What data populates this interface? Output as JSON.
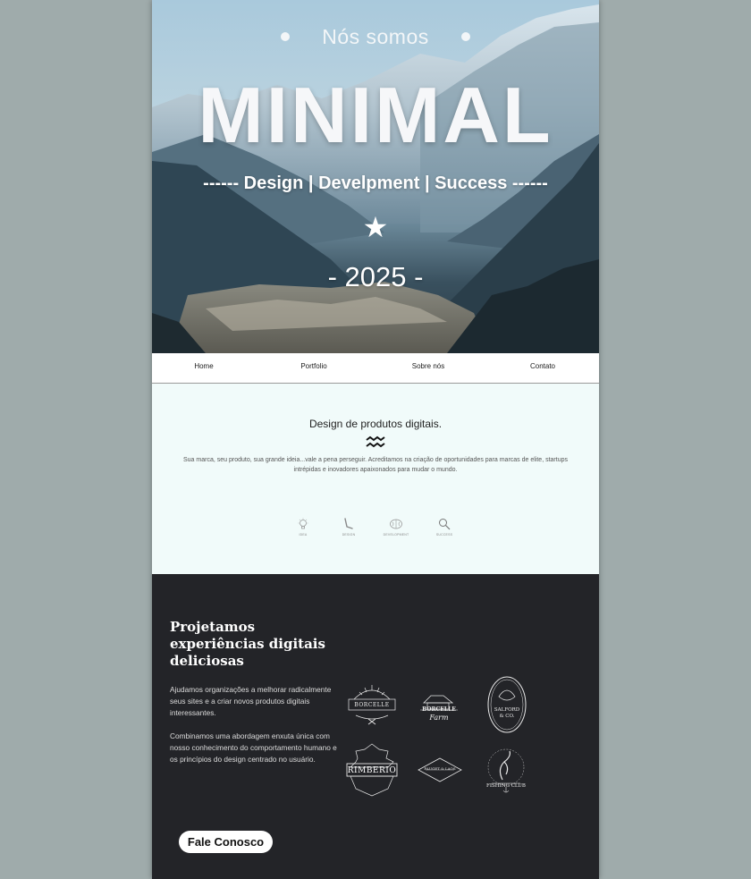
{
  "hero": {
    "eyebrow": "Nós somos",
    "title": "MINIMAL",
    "tagline": "------ Design | Develpment | Success ------",
    "star": "★",
    "year": "- 2025 -"
  },
  "nav": {
    "items": [
      {
        "label": "Home"
      },
      {
        "label": "Portfolio"
      },
      {
        "label": "Sobre nós"
      },
      {
        "label": "Contato"
      }
    ]
  },
  "intro": {
    "heading": "Design de produtos digitais.",
    "body": "Sua marca, seu produto, sua grande ideia...vale a pena perseguir. Acreditamos na criação de oportunidades para marcas de elite, startups intrépidas e inovadores apaixonados para mudar o mundo.",
    "features": [
      {
        "label": "IDEA",
        "icon": "lightbulb-icon"
      },
      {
        "label": "DESIGN",
        "icon": "pen-icon"
      },
      {
        "label": "DEVELOPMENT",
        "icon": "brain-icon"
      },
      {
        "label": "SUCCESS",
        "icon": "magnifier-icon"
      }
    ]
  },
  "about": {
    "heading": "Projetamos experiências digitais deliciosas",
    "paragraph1": "Ajudamos organizações a melhorar radicalmente seus sites e a criar novos produtos digitais interessantes.",
    "paragraph2": "Combinamos uma abordagem enxuta única com nosso conhecimento do comportamento humano e os princípios do design centrado no usuário.",
    "cta": "Fale Conosco",
    "logos": [
      {
        "name": "BORCELLE",
        "sub": ""
      },
      {
        "name": "BORCELLE",
        "sub": "Farm"
      },
      {
        "name": "SALFORD",
        "sub": "& CO."
      },
      {
        "name": "RIMBERIO",
        "sub": ""
      },
      {
        "name": "FAUGET & LAOS",
        "sub": ""
      },
      {
        "name": "FISHING CLUB",
        "sub": ""
      }
    ]
  },
  "colors": {
    "page_bg": "#9fabab",
    "dark_section": "#232428",
    "intro_bg": "#f1fbfa"
  }
}
